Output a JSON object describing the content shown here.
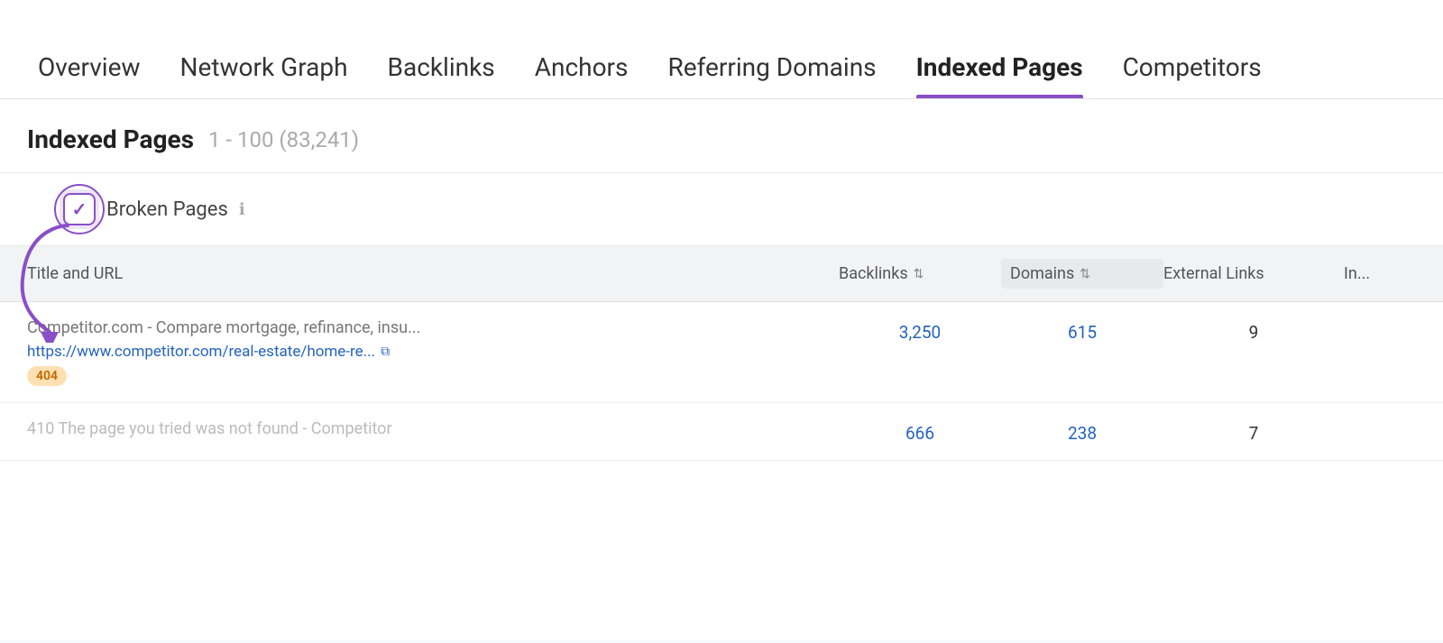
{
  "nav": {
    "items": [
      {
        "label": "Overview",
        "active": false
      },
      {
        "label": "Network Graph",
        "active": false
      },
      {
        "label": "Backlinks",
        "active": false
      },
      {
        "label": "Anchors",
        "active": false
      },
      {
        "label": "Referring Domains",
        "active": false
      },
      {
        "label": "Indexed Pages",
        "active": true
      },
      {
        "label": "Competitors",
        "active": false
      }
    ]
  },
  "page": {
    "title": "Indexed Pages",
    "subtitle": "1 - 100 (83,241)"
  },
  "filter": {
    "label": "Broken Pages",
    "info_label": "ℹ"
  },
  "table": {
    "columns": [
      {
        "label": "Title and URL"
      },
      {
        "label": "Backlinks",
        "sortable": true
      },
      {
        "label": "Domains",
        "sortable": true
      },
      {
        "label": "External Links",
        "sortable": false
      },
      {
        "label": "In..."
      }
    ],
    "rows": [
      {
        "title": "Competitor.com - Compare mortgage, refinance, insu...",
        "url": "https://www.competitor.com/real-estate/home-re...",
        "status": "404",
        "backlinks": "3,250",
        "domains": "615",
        "external_links": "9"
      },
      {
        "title": "410 The page you tried was not found - Competitor",
        "url": "",
        "status": "",
        "backlinks": "666",
        "domains": "238",
        "external_links": "7"
      }
    ]
  }
}
